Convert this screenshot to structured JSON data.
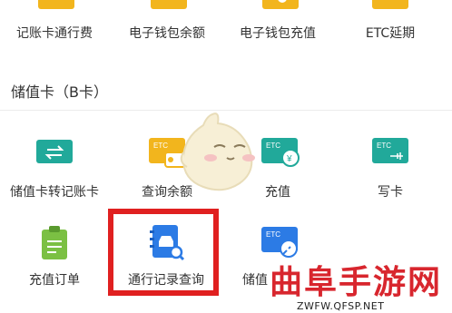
{
  "top_row": [
    {
      "label": "记账卡通行费",
      "icon": "card-toll-icon"
    },
    {
      "label": "电子钱包余额",
      "icon": "wallet-balance-icon"
    },
    {
      "label": "电子钱包充值",
      "icon": "wallet-recharge-icon"
    },
    {
      "label": "ETC延期",
      "icon": "etc-extend-icon"
    }
  ],
  "section": {
    "title": "储值卡（B卡）"
  },
  "row1": [
    {
      "label": "储值卡转记账卡",
      "icon": "card-transfer-icon"
    },
    {
      "label": "查询余额",
      "icon": "etc-balance-icon",
      "badge": "ETC"
    },
    {
      "label": "充值",
      "icon": "etc-recharge-icon",
      "badge": "ETC"
    },
    {
      "label": "写卡",
      "icon": "etc-write-card-icon",
      "badge": "ETC"
    }
  ],
  "row2": [
    {
      "label": "充值订单",
      "icon": "recharge-order-icon"
    },
    {
      "label": "通行记录查询",
      "icon": "trip-record-search-icon"
    },
    {
      "label": "储值",
      "icon": "etc-key-icon",
      "badge": "ETC"
    }
  ],
  "watermark": {
    "text": "曲阜手游网",
    "url": "ZWFW.QFSP.NET"
  },
  "colors": {
    "teal": "#21a99a",
    "yellow": "#f2b51d",
    "blue": "#2c7be5",
    "green": "#7bc043",
    "red": "#e02020"
  }
}
